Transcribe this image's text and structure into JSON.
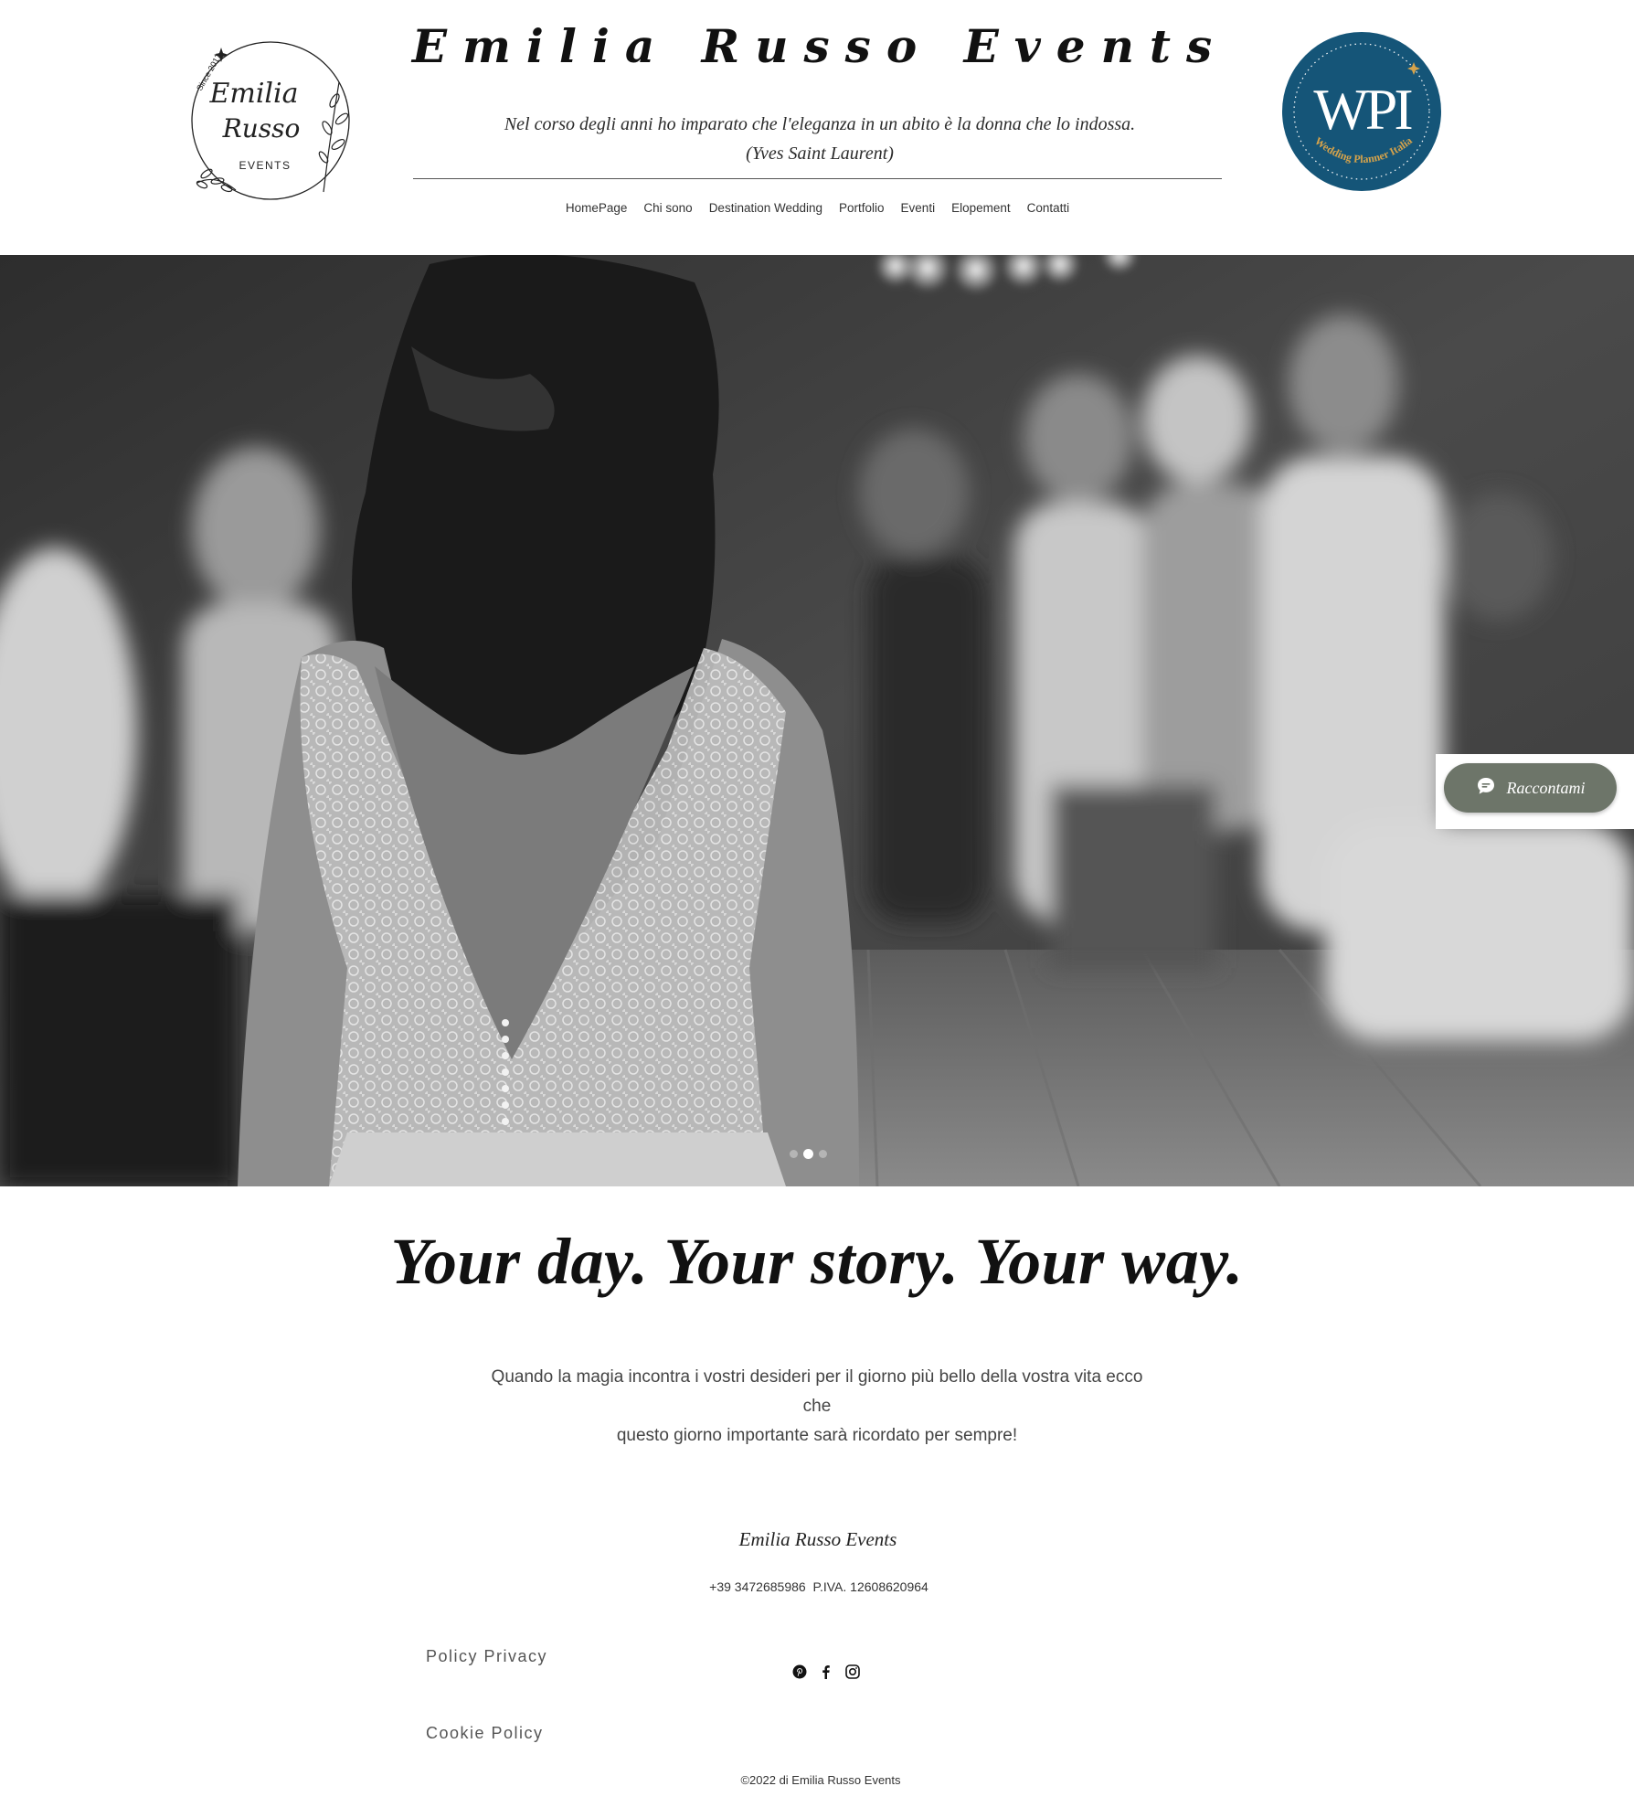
{
  "header": {
    "logo_left": {
      "script": "Emilia Russo",
      "events": "EVENTS",
      "since": "Since 2017"
    },
    "site_title": "Emilia Russo Events",
    "quote": "Nel corso degli anni ho imparato che l'eleganza in un abito è la donna che lo indossa.",
    "quote_author": "(Yves Saint Laurent)",
    "logo_right": {
      "initials": "WPI",
      "ring_text": "Wedding Planner Italia"
    }
  },
  "nav": {
    "items": [
      {
        "label": "HomePage"
      },
      {
        "label": "Chi sono"
      },
      {
        "label": "Destination Wedding"
      },
      {
        "label": "Portfolio"
      },
      {
        "label": "Eventi"
      },
      {
        "label": "Elopement"
      },
      {
        "label": "Contatti"
      }
    ]
  },
  "hero": {
    "slides_total": 3,
    "active_slide": 1
  },
  "chat": {
    "label": "Raccontami",
    "icon": "chat-bubble-icon",
    "color": "#6d7569"
  },
  "main": {
    "tagline": "Your day. Your story. Your way.",
    "intro_line1": "Quando la magia incontra i vostri desideri per il giorno più bello della vostra vita ecco che",
    "intro_line2": "questo giorno importante sarà ricordato per sempre!"
  },
  "footer": {
    "brand": "Emilia Russo Events",
    "contact": "+39 3472685986  P.IVA. 12608620964",
    "policy_privacy": "Policy Privacy",
    "cookie_policy": "Cookie Policy",
    "social": [
      "pinterest-icon",
      "facebook-icon",
      "instagram-icon"
    ],
    "copyright": "©2022 di Emilia Russo Events"
  },
  "colors": {
    "wpi_badge": "#155578",
    "wpi_accent": "#d6a34b",
    "chat_button": "#6d7569"
  }
}
